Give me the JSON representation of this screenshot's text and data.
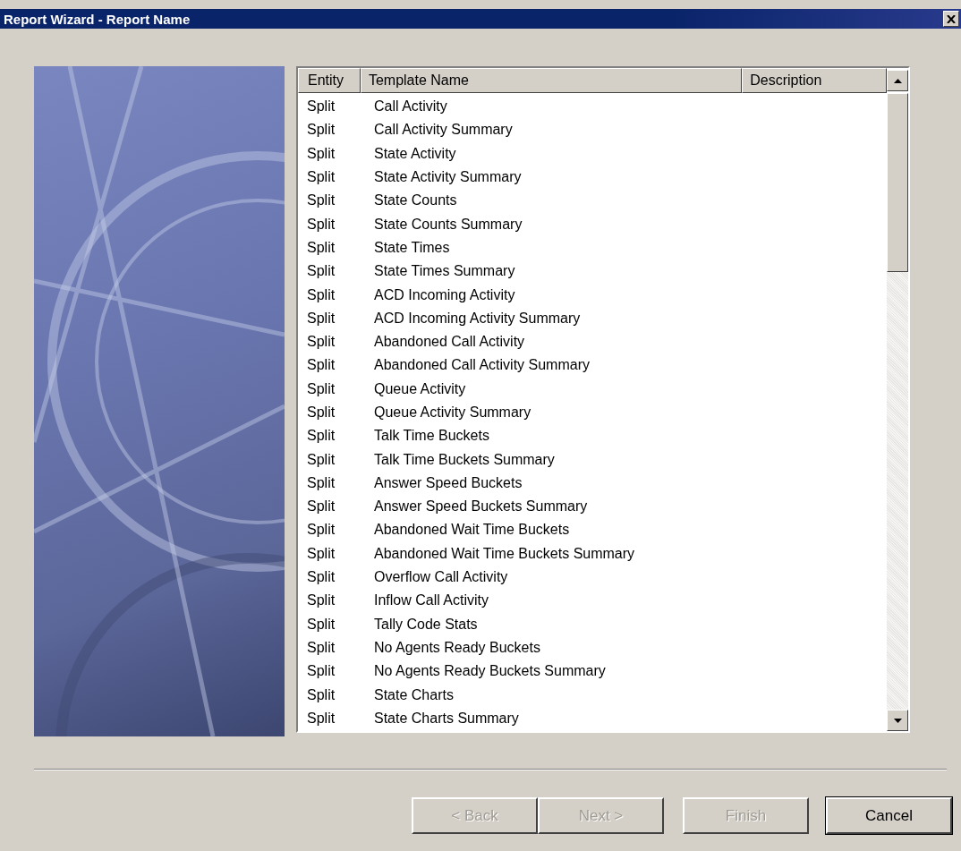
{
  "window": {
    "title": "Report Wizard - Report Name"
  },
  "table": {
    "columns": [
      "Entity",
      "Template Name",
      "Description"
    ],
    "rows": [
      {
        "entity": "Split",
        "template": "Call Activity"
      },
      {
        "entity": "Split",
        "template": "Call Activity Summary"
      },
      {
        "entity": "Split",
        "template": "State Activity"
      },
      {
        "entity": "Split",
        "template": "State Activity Summary"
      },
      {
        "entity": "Split",
        "template": "State Counts"
      },
      {
        "entity": "Split",
        "template": "State Counts Summary"
      },
      {
        "entity": "Split",
        "template": "State Times"
      },
      {
        "entity": "Split",
        "template": "State Times Summary"
      },
      {
        "entity": "Split",
        "template": "ACD Incoming Activity"
      },
      {
        "entity": "Split",
        "template": "ACD Incoming Activity Summary"
      },
      {
        "entity": "Split",
        "template": "Abandoned Call Activity"
      },
      {
        "entity": "Split",
        "template": "Abandoned Call Activity Summary"
      },
      {
        "entity": "Split",
        "template": "Queue Activity"
      },
      {
        "entity": "Split",
        "template": "Queue Activity Summary"
      },
      {
        "entity": "Split",
        "template": "Talk Time Buckets"
      },
      {
        "entity": "Split",
        "template": "Talk Time Buckets Summary"
      },
      {
        "entity": "Split",
        "template": "Answer Speed Buckets"
      },
      {
        "entity": "Split",
        "template": "Answer Speed Buckets Summary"
      },
      {
        "entity": "Split",
        "template": "Abandoned Wait Time Buckets"
      },
      {
        "entity": "Split",
        "template": "Abandoned Wait Time Buckets Summary"
      },
      {
        "entity": "Split",
        "template": "Overflow Call Activity"
      },
      {
        "entity": "Split",
        "template": "Inflow Call Activity"
      },
      {
        "entity": "Split",
        "template": "Tally Code Stats"
      },
      {
        "entity": "Split",
        "template": "No Agents Ready Buckets"
      },
      {
        "entity": "Split",
        "template": "No Agents Ready Buckets Summary"
      },
      {
        "entity": "Split",
        "template": "State Charts"
      },
      {
        "entity": "Split",
        "template": "State Charts Summary"
      }
    ]
  },
  "buttons": [
    {
      "label": "< Back",
      "disabled": true,
      "kind": "nav"
    },
    {
      "label": "Next >",
      "disabled": true,
      "kind": "nav"
    },
    {
      "label": "Finish",
      "disabled": true,
      "kind": "action"
    },
    {
      "label": "Cancel",
      "disabled": false,
      "kind": "default"
    }
  ]
}
